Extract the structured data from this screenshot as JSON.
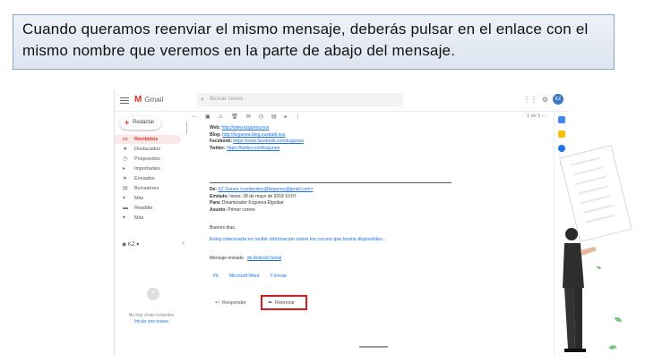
{
  "caption": "Cuando queramos reenviar el mismo mensaje, deberás pulsar en el enlace con el mismo nombre que veremos en la parte de abajo del mensaje.",
  "header": {
    "app_name": "Gmail",
    "search_placeholder": "Buscar correo",
    "avatar_initials": "KZ"
  },
  "sidebar": {
    "compose_label": "Redactar",
    "items": [
      {
        "icon": "inbox-icon",
        "label": "Recibidos",
        "active": true
      },
      {
        "icon": "star-icon",
        "label": "Destacados",
        "active": false
      },
      {
        "icon": "clock-icon",
        "label": "Pospuestos",
        "active": false
      },
      {
        "icon": "label-icon",
        "label": "Importantes",
        "active": false
      },
      {
        "icon": "send-icon",
        "label": "Enviados",
        "active": false
      },
      {
        "icon": "file-icon",
        "label": "Borradores",
        "active": false
      },
      {
        "icon": "chevron-down-icon",
        "label": "Más",
        "active": false
      },
      {
        "icon": "tag-icon",
        "label": "Readdle",
        "active": false
      },
      {
        "icon": "folder-icon",
        "label": "Más",
        "active": false
      }
    ],
    "hangouts_user": "KZ",
    "no_chats_text": "No hay chats recientes",
    "start_chat_link": "Iniciar uno nuevo"
  },
  "main": {
    "pager": "1 de 5",
    "quoted": {
      "web_label": "Web:",
      "web_value": "http://www.kzgunea.eus",
      "blog_label": "Blog:",
      "blog_value": "http://kzgunea.blog.euskadi.eus",
      "facebook_label": "Facebook:",
      "facebook_value": "https://www.facebook.com/kzgunea",
      "twitter_label": "Twitter:",
      "twitter_value": "https://twitter.com/kzgunea"
    },
    "forwarded": {
      "from_label": "De:",
      "from_value": "KZ Gunea <contenidos@kzgunea@gmail.com>",
      "date_label": "Enviado:",
      "date_value": "lunes, 28 de mayo de 2018 10:07",
      "to_label": "Para:",
      "to_value": "Dinamizador Kzgunea Elgoibar",
      "subject_label": "Asunto:",
      "subject_value": "Primer correo"
    },
    "greeting": "Buenos días,",
    "body": "Estoy interesada en recibir información sobre los cursos que tenéis disponibles...",
    "signature_prefix": "Mensaje enviado",
    "signature_link": "de Android Gmail",
    "links": [
      "Fb",
      "Microsoft Word",
      "Y Enviar"
    ],
    "reply_label": "Responder",
    "forward_label": "Reenviar"
  },
  "colors": {
    "gmail_red": "#d93025",
    "highlight_red": "#d41c1c",
    "link_blue": "#1a73e8",
    "caption_border": "#8aa6cc"
  }
}
